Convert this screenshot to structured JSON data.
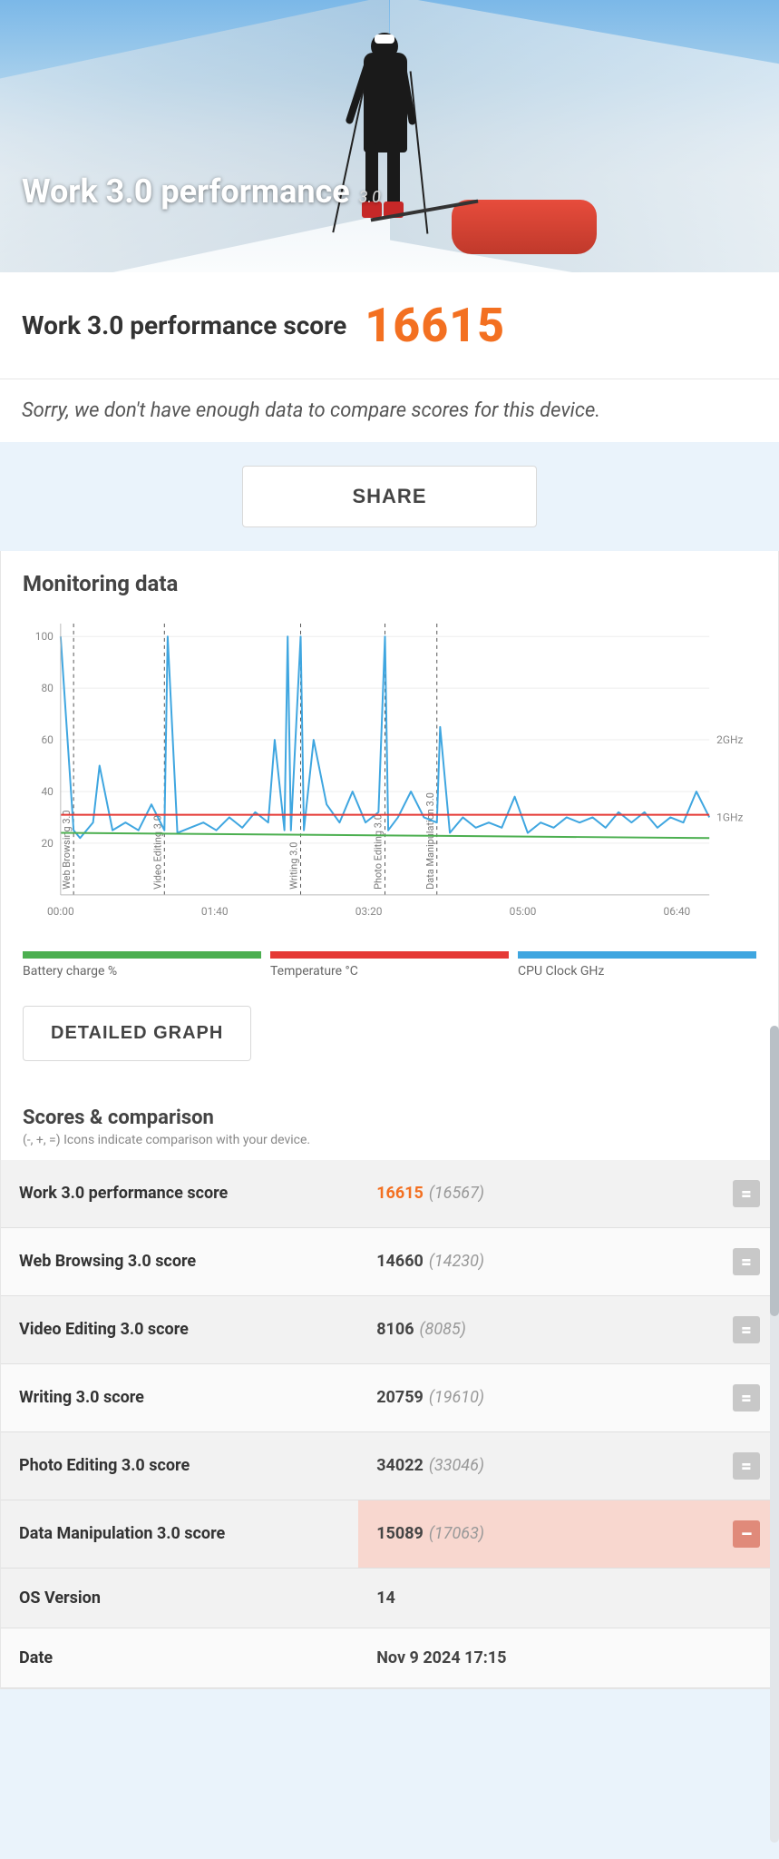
{
  "hero": {
    "title": "Work 3.0 performance",
    "suffix": "3.0"
  },
  "score": {
    "label": "Work 3.0 performance score",
    "value": "16615"
  },
  "compare_note": "Sorry, we don't have enough data to compare scores for this device.",
  "share_button": "SHARE",
  "monitoring": {
    "title": "Monitoring data",
    "legend": {
      "battery": "Battery charge %",
      "temperature": "Temperature °C",
      "cpu": "CPU Clock GHz"
    },
    "detailed_button": "DETAILED GRAPH"
  },
  "chart_data": {
    "type": "line",
    "x_ticks": [
      "00:00",
      "01:40",
      "03:20",
      "05:00",
      "06:40"
    ],
    "y_ticks_left": [
      20,
      40,
      60,
      80,
      100
    ],
    "y_ticks_right": [
      "1GHz",
      "2GHz"
    ],
    "ylim_left": [
      0,
      105
    ],
    "sections": [
      {
        "name": "Web Browsing 3.0",
        "x": 0.02
      },
      {
        "name": "Video Editing 3.0",
        "x": 0.16
      },
      {
        "name": "Writing 3.0",
        "x": 0.37
      },
      {
        "name": "Photo Editing 3.0",
        "x": 0.5
      },
      {
        "name": "Data Manipulation 3.0",
        "x": 0.58
      }
    ],
    "series": [
      {
        "name": "CPU Clock GHz",
        "color": "#3fa6e0",
        "x": [
          0,
          0.02,
          0.03,
          0.05,
          0.06,
          0.08,
          0.1,
          0.12,
          0.14,
          0.16,
          0.165,
          0.18,
          0.2,
          0.22,
          0.24,
          0.26,
          0.28,
          0.3,
          0.32,
          0.33,
          0.345,
          0.35,
          0.355,
          0.37,
          0.375,
          0.39,
          0.41,
          0.43,
          0.45,
          0.47,
          0.49,
          0.5,
          0.505,
          0.52,
          0.54,
          0.56,
          0.58,
          0.585,
          0.6,
          0.62,
          0.64,
          0.66,
          0.68,
          0.7,
          0.72,
          0.74,
          0.76,
          0.78,
          0.8,
          0.82,
          0.84,
          0.86,
          0.88,
          0.9,
          0.92,
          0.94,
          0.96,
          0.98,
          1.0
        ],
        "y": [
          100,
          25,
          22,
          28,
          50,
          25,
          28,
          25,
          35,
          25,
          100,
          24,
          26,
          28,
          25,
          30,
          26,
          32,
          28,
          60,
          25,
          100,
          25,
          100,
          25,
          60,
          35,
          28,
          40,
          28,
          32,
          100,
          25,
          30,
          40,
          30,
          28,
          65,
          24,
          30,
          26,
          28,
          26,
          38,
          24,
          28,
          26,
          30,
          28,
          30,
          26,
          32,
          28,
          32,
          26,
          30,
          28,
          40,
          30
        ]
      },
      {
        "name": "Temperature °C",
        "color": "#e53935",
        "x": [
          0,
          0.5,
          1.0
        ],
        "y": [
          31,
          31,
          31
        ]
      },
      {
        "name": "Battery charge %",
        "color": "#4caf50",
        "x": [
          0,
          0.5,
          1.0
        ],
        "y": [
          24,
          23,
          22
        ]
      }
    ]
  },
  "scores_section": {
    "title": "Scores & comparison",
    "subtitle": "(-, +, =) Icons indicate comparison with your device.",
    "rows": [
      {
        "label": "Work 3.0 performance score",
        "value": "16615",
        "paren": "(16567)",
        "highlight": true,
        "badge": "eq"
      },
      {
        "label": "Web Browsing 3.0 score",
        "value": "14660",
        "paren": "(14230)",
        "highlight": false,
        "badge": "eq"
      },
      {
        "label": "Video Editing 3.0 score",
        "value": "8106",
        "paren": "(8085)",
        "highlight": false,
        "badge": "eq"
      },
      {
        "label": "Writing 3.0 score",
        "value": "20759",
        "paren": "(19610)",
        "highlight": false,
        "badge": "eq"
      },
      {
        "label": "Photo Editing 3.0 score",
        "value": "34022",
        "paren": "(33046)",
        "highlight": false,
        "badge": "eq"
      },
      {
        "label": "Data Manipulation 3.0 score",
        "value": "15089",
        "paren": "(17063)",
        "highlight": false,
        "badge": "minus"
      },
      {
        "label": "OS Version",
        "value": "14",
        "paren": "",
        "highlight": false,
        "badge": ""
      },
      {
        "label": "Date",
        "value": "Nov 9 2024 17:15",
        "paren": "",
        "highlight": false,
        "badge": ""
      }
    ]
  }
}
